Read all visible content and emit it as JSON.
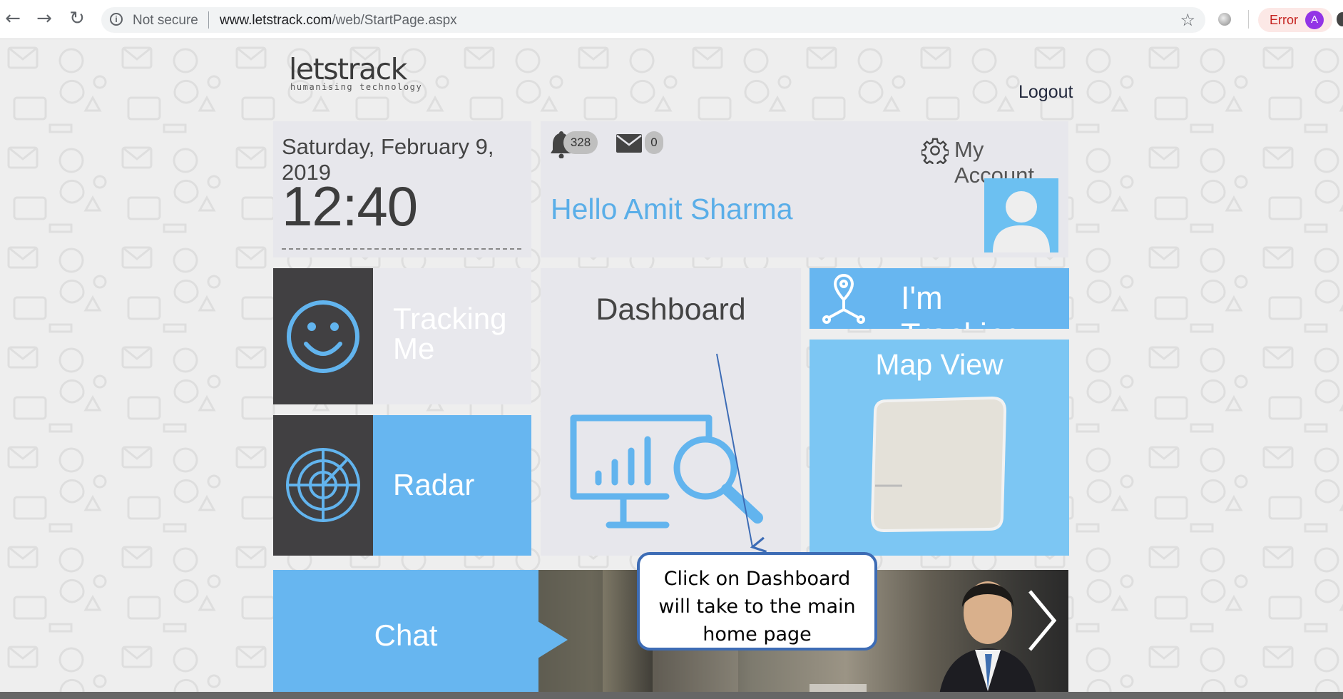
{
  "browser": {
    "security_label": "Not secure",
    "url_host": "www.letstrack.com",
    "url_path": "/web/StartPage.aspx",
    "error_label": "Error",
    "profile_initial": "A",
    "icons": [
      "back-icon",
      "forward-icon",
      "reload-icon",
      "info-icon",
      "star-icon",
      "extension-icon"
    ]
  },
  "header": {
    "logo_word": "letstrack",
    "logo_tagline": "humanising technology",
    "logout_label": "Logout"
  },
  "clock": {
    "date": "Saturday, February 9, 2019",
    "time": "12:40"
  },
  "profile": {
    "notification_count": "328",
    "message_count": "0",
    "account_label": "My Account",
    "greeting": "Hello Amit Sharma"
  },
  "tiles": {
    "tracking_me": "Tracking Me",
    "radar": "Radar",
    "dashboard": "Dashboard",
    "im_tracking": "I'm Tracking",
    "map_view": "Map View",
    "chat": "Chat"
  },
  "annotation": {
    "text": "Click on Dashboard\nwill take to the main\nhome page"
  },
  "colors": {
    "accent_blue": "#67b6f0",
    "dark_tile": "#414042",
    "callout_border": "#3d6cb5"
  }
}
